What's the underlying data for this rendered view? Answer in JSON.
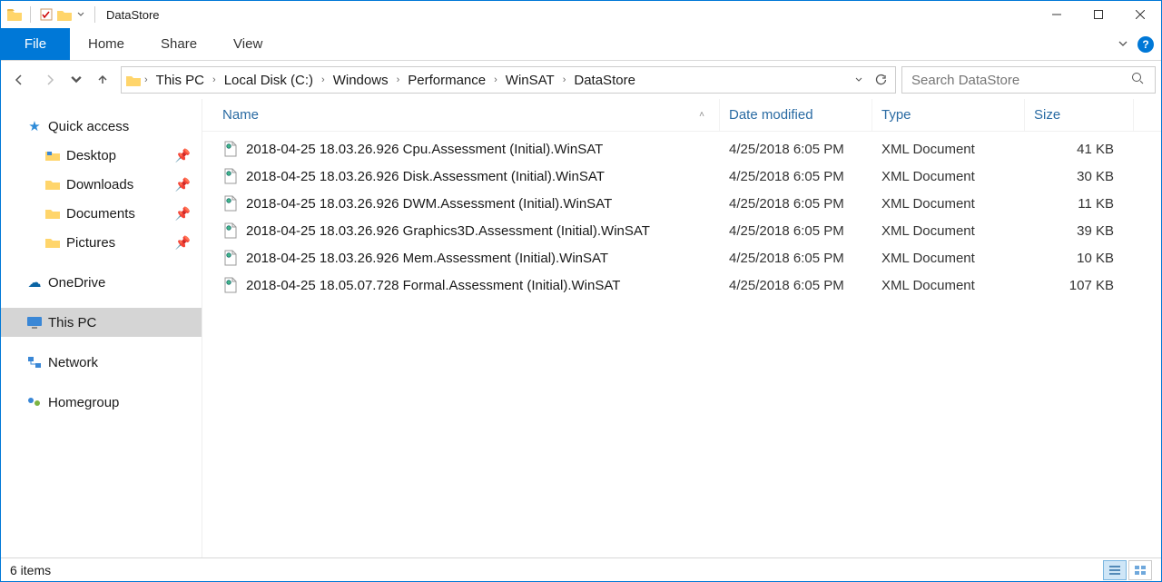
{
  "window": {
    "title": "DataStore"
  },
  "ribbon": {
    "file": "File",
    "tabs": [
      "Home",
      "Share",
      "View"
    ]
  },
  "breadcrumb": [
    "This PC",
    "Local Disk (C:)",
    "Windows",
    "Performance",
    "WinSAT",
    "DataStore"
  ],
  "search": {
    "placeholder": "Search DataStore"
  },
  "columns": {
    "name": "Name",
    "date": "Date modified",
    "type": "Type",
    "size": "Size"
  },
  "navpane": {
    "quick_access": "Quick access",
    "pinned": [
      "Desktop",
      "Downloads",
      "Documents",
      "Pictures"
    ],
    "onedrive": "OneDrive",
    "this_pc": "This PC",
    "network": "Network",
    "homegroup": "Homegroup"
  },
  "files": [
    {
      "name": "2018-04-25 18.03.26.926 Cpu.Assessment (Initial).WinSAT",
      "date": "4/25/2018 6:05 PM",
      "type": "XML Document",
      "size": "41 KB"
    },
    {
      "name": "2018-04-25 18.03.26.926 Disk.Assessment (Initial).WinSAT",
      "date": "4/25/2018 6:05 PM",
      "type": "XML Document",
      "size": "30 KB"
    },
    {
      "name": "2018-04-25 18.03.26.926 DWM.Assessment (Initial).WinSAT",
      "date": "4/25/2018 6:05 PM",
      "type": "XML Document",
      "size": "11 KB"
    },
    {
      "name": "2018-04-25 18.03.26.926 Graphics3D.Assessment (Initial).WinSAT",
      "date": "4/25/2018 6:05 PM",
      "type": "XML Document",
      "size": "39 KB"
    },
    {
      "name": "2018-04-25 18.03.26.926 Mem.Assessment (Initial).WinSAT",
      "date": "4/25/2018 6:05 PM",
      "type": "XML Document",
      "size": "10 KB"
    },
    {
      "name": "2018-04-25 18.05.07.728 Formal.Assessment (Initial).WinSAT",
      "date": "4/25/2018 6:05 PM",
      "type": "XML Document",
      "size": "107 KB"
    }
  ],
  "status": {
    "count": "6 items"
  }
}
